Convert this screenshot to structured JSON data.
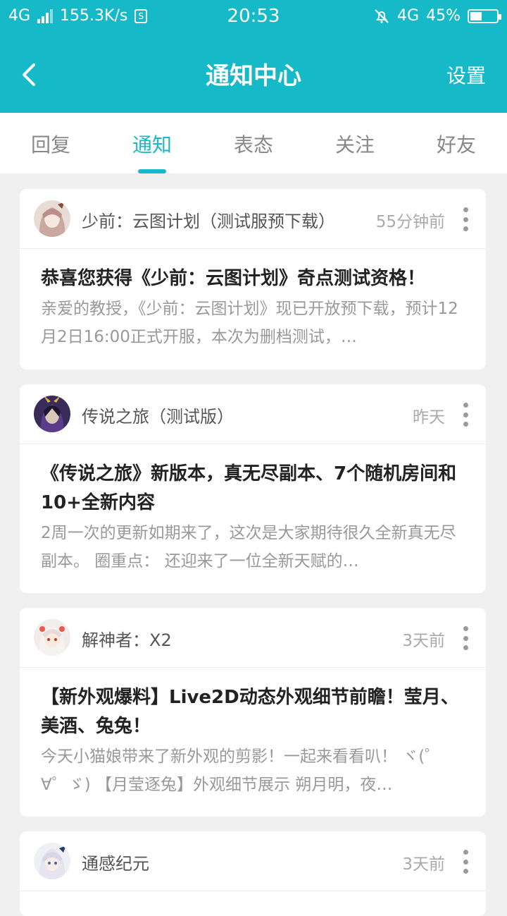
{
  "status": {
    "network": "4G",
    "speed": "155.3K/s",
    "time": "20:53",
    "network2": "4G",
    "battery": "45%",
    "battery_level": 0.45
  },
  "header": {
    "title": "通知中心",
    "settings": "设置"
  },
  "tabs": [
    {
      "label": "回复"
    },
    {
      "label": "通知"
    },
    {
      "label": "表态"
    },
    {
      "label": "关注"
    },
    {
      "label": "好友"
    }
  ],
  "active_tab": "通知",
  "notifications": [
    {
      "source": "少前：云图计划（测试服预下载）",
      "time": "55分钟前",
      "headline": "恭喜您获得《少前：云图计划》奇点测试资格！",
      "excerpt": "亲爱的教授，《少前：云图计划》现已开放预下载，预计12月2日16:00正式开服，本次为删档测试，…"
    },
    {
      "source": "传说之旅（测试版）",
      "time": "昨天",
      "headline": "《传说之旅》新版本，真无尽副本、7个随机房间和10+全新内容",
      "excerpt": "2周一次的更新如期来了，这次是大家期待很久全新真无尽副本。 圈重点： 还迎来了一位全新天赋的…"
    },
    {
      "source": "解神者：X2",
      "time": "3天前",
      "headline": "【新外观爆料】Live2D动态外观细节前瞻！莹月、美酒、兔兔！",
      "excerpt": "今天小猫娘带来了新外观的剪影！一起来看看叭！ ヾ(゜∀゜ゞ) 【月莹逐兔】外观细节展示 朔月明，夜…"
    },
    {
      "source": "通感纪元",
      "time": "3天前"
    }
  ],
  "colors": {
    "accent": "#16b9c7"
  }
}
